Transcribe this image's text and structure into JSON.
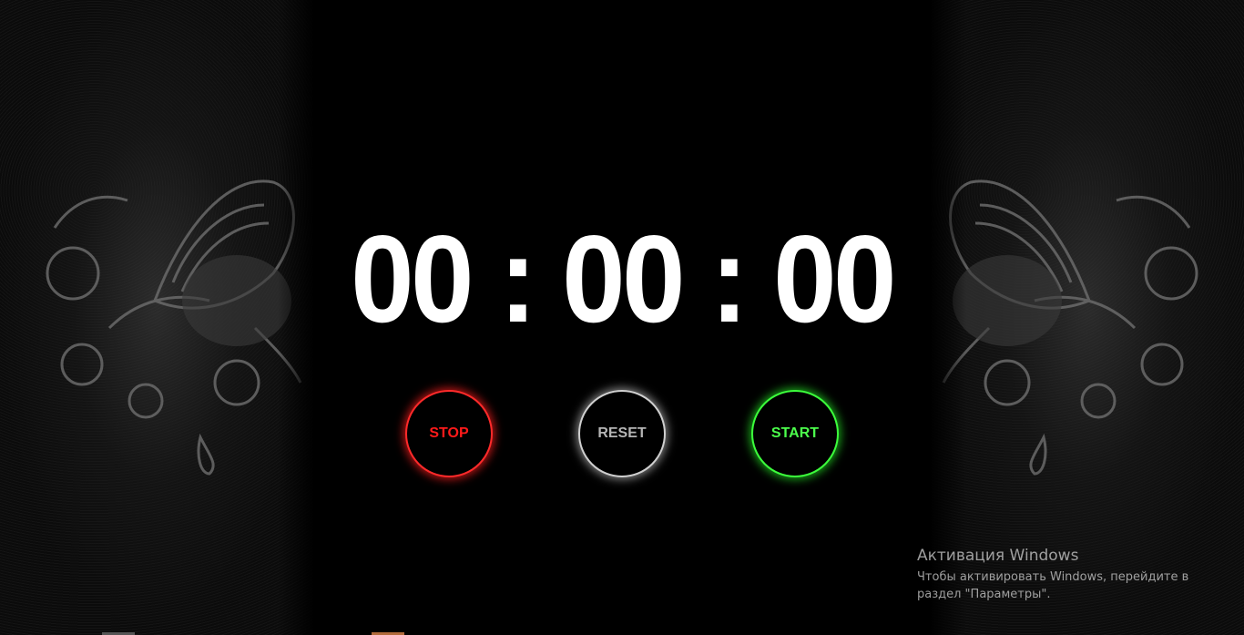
{
  "timer": {
    "hours": "00",
    "minutes": "00",
    "seconds": "00",
    "separator": ":"
  },
  "buttons": {
    "stop_label": "STOP",
    "reset_label": "RESET",
    "start_label": "START"
  },
  "colors": {
    "stop": "#ff2a2a",
    "reset": "#cfcfcf",
    "start": "#3cff3c",
    "background": "#000000"
  },
  "windows_activation": {
    "title": "Активация Windows",
    "description": "Чтобы активировать Windows, перейдите в раздел \"Параметры\"."
  }
}
